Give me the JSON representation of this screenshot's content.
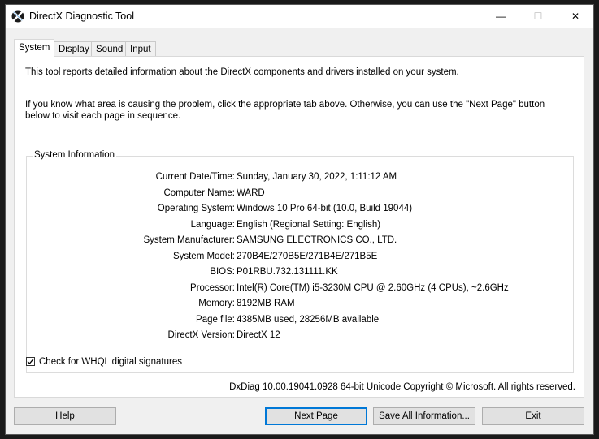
{
  "window": {
    "title": "DirectX Diagnostic Tool",
    "minimize_glyph": "—",
    "maximize_glyph": "☐",
    "close_glyph": "✕"
  },
  "tabs": [
    {
      "label": "System",
      "active": true
    },
    {
      "label": "Display",
      "active": false
    },
    {
      "label": "Sound",
      "active": false
    },
    {
      "label": "Input",
      "active": false
    }
  ],
  "intro": {
    "line1": "This tool reports detailed information about the DirectX components and drivers installed on your system.",
    "line2": "If you know what area is causing the problem, click the appropriate tab above.  Otherwise, you can use the \"Next Page\" button below to visit each page in sequence."
  },
  "system_info": {
    "title": "System Information",
    "rows": [
      {
        "label": "Current Date/Time:",
        "value": "Sunday, January 30, 2022, 1:11:12 AM"
      },
      {
        "label": "Computer Name:",
        "value": "WARD"
      },
      {
        "label": "Operating System:",
        "value": "Windows 10 Pro 64-bit (10.0, Build 19044)"
      },
      {
        "label": "Language:",
        "value": "English (Regional Setting: English)"
      },
      {
        "label": "System Manufacturer:",
        "value": "SAMSUNG ELECTRONICS CO., LTD."
      },
      {
        "label": "System Model:",
        "value": "270B4E/270B5E/271B4E/271B5E"
      },
      {
        "label": "BIOS:",
        "value": "P01RBU.732.131111.KK"
      },
      {
        "label": "Processor:",
        "value": "Intel(R) Core(TM) i5-3230M CPU @ 2.60GHz (4 CPUs), ~2.6GHz"
      },
      {
        "label": "Memory:",
        "value": "8192MB RAM"
      },
      {
        "label": "Page file:",
        "value": "4385MB used, 28256MB available"
      },
      {
        "label": "DirectX Version:",
        "value": "DirectX 12"
      }
    ]
  },
  "whql": {
    "label": "Check for WHQL digital signatures",
    "checked": true
  },
  "footer": "DxDiag 10.00.19041.0928 64-bit Unicode  Copyright © Microsoft. All rights reserved.",
  "buttons": {
    "help": {
      "first": "H",
      "rest": "elp"
    },
    "next_page": {
      "first": "N",
      "rest": "ext Page"
    },
    "save_all": {
      "first": "S",
      "rest": "ave All Information..."
    },
    "exit": {
      "first": "E",
      "rest": "xit"
    }
  },
  "colors": {
    "accent": "#0078d7",
    "window_bg": "#f0f0f0",
    "panel_bg": "#ffffff"
  }
}
